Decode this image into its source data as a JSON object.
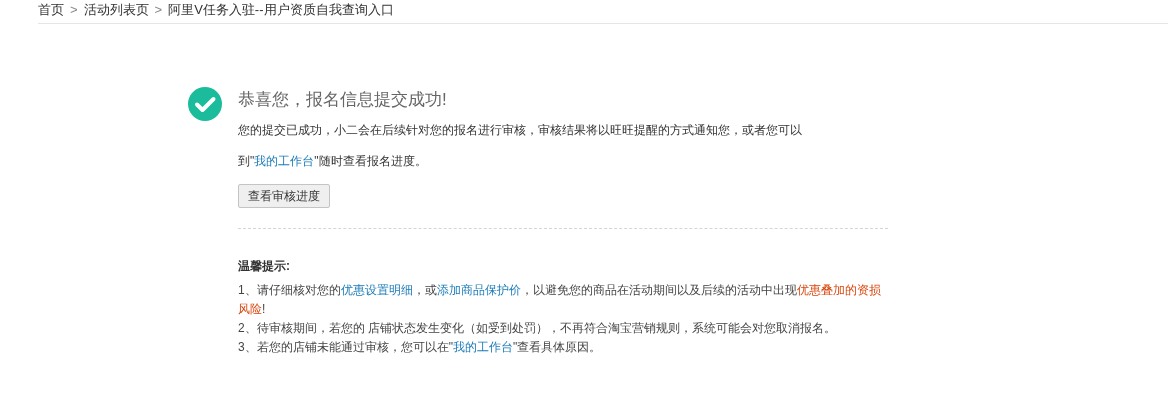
{
  "breadcrumb": [
    {
      "label": "首页",
      "kind": "link"
    },
    {
      "label": ">",
      "kind": "separator"
    },
    {
      "label": "活动列表页",
      "kind": "link"
    },
    {
      "label": ">",
      "kind": "separator"
    },
    {
      "label": "阿里V任务入驻--用户资质自我查询入口",
      "kind": "current"
    }
  ],
  "success": {
    "title": "恭喜您，报名信息提交成功!",
    "message": [
      {
        "text": "您的提交已成功，小二会在后续针对您的报名进行审核，审核结果将以旺旺提醒的方式通知您，或者您可以到\"",
        "kind": "text"
      },
      {
        "text": "我的工作台",
        "kind": "link"
      },
      {
        "text": "\"随时查看报名进度。",
        "kind": "text"
      }
    ],
    "button": "查看审核进度"
  },
  "tips": {
    "title": "温馨提示:",
    "items": [
      [
        {
          "text": "1、请仔细核对您的",
          "kind": "text"
        },
        {
          "text": "优惠设置明细",
          "kind": "link"
        },
        {
          "text": "，或",
          "kind": "text"
        },
        {
          "text": "添加商品保护价",
          "kind": "link"
        },
        {
          "text": "，以避免您的商品在活动期间以及后续的活动中出现",
          "kind": "text"
        },
        {
          "text": "优惠叠加的资损风险",
          "kind": "warning"
        },
        {
          "text": "!",
          "kind": "text"
        }
      ],
      [
        {
          "text": "2、待审核期间，若您的 店铺状态发生变化（如受到处罚），不再符合淘宝营销规则，系统可能会对您取消报名。",
          "kind": "text"
        }
      ],
      [
        {
          "text": "3、若您的店铺未能通过审核，您可以在\"",
          "kind": "text"
        },
        {
          "text": "我的工作台",
          "kind": "link"
        },
        {
          "text": "\"查看具体原因。",
          "kind": "text"
        }
      ]
    ]
  }
}
